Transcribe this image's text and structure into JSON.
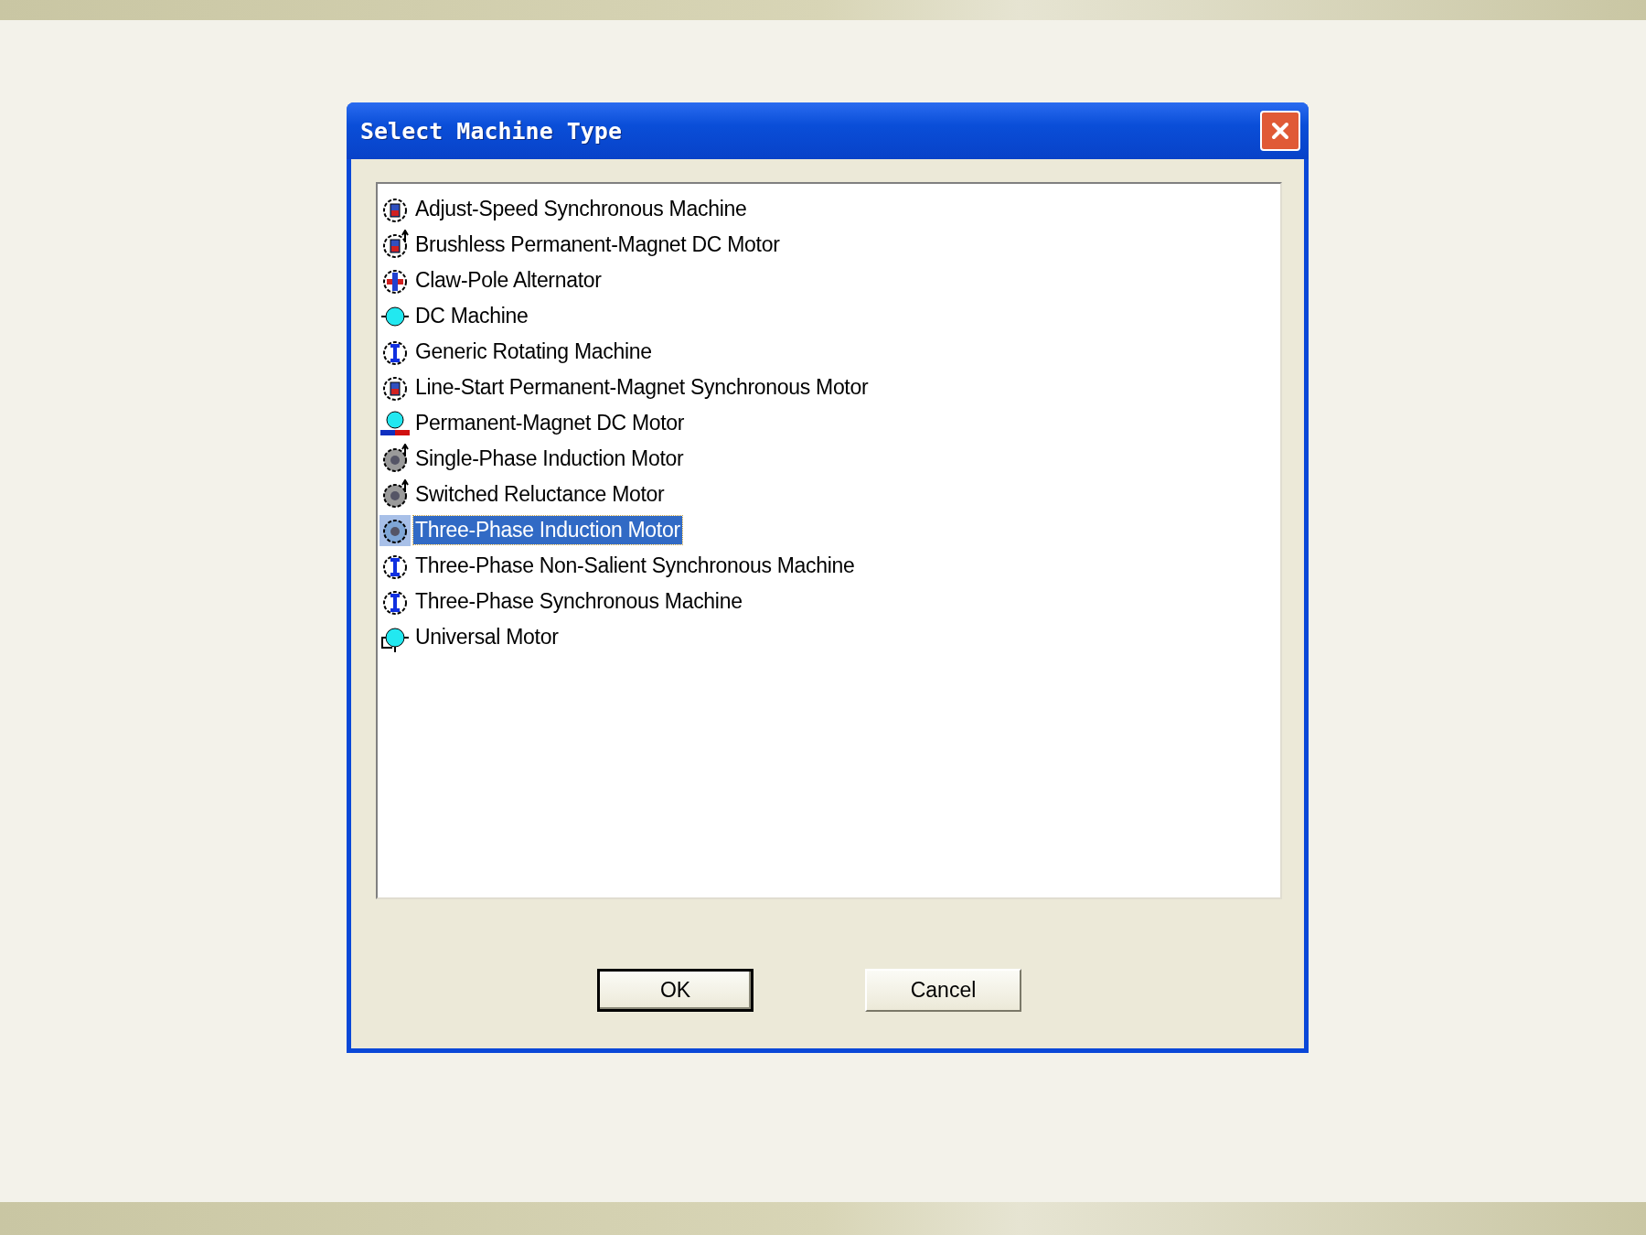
{
  "window": {
    "title": "Select Machine Type"
  },
  "machine_types": [
    {
      "label": "Adjust-Speed  Synchronous Machine",
      "selected": false
    },
    {
      "label": "Brushless Permanent-Magnet DC Motor",
      "selected": false
    },
    {
      "label": "Claw-Pole Alternator",
      "selected": false
    },
    {
      "label": "DC Machine",
      "selected": false
    },
    {
      "label": "Generic Rotating Machine",
      "selected": false
    },
    {
      "label": "Line-Start Permanent-Magnet Synchronous Motor",
      "selected": false
    },
    {
      "label": "Permanent-Magnet DC Motor",
      "selected": false
    },
    {
      "label": "Single-Phase Induction Motor",
      "selected": false
    },
    {
      "label": "Switched Reluctance Motor",
      "selected": false
    },
    {
      "label": "Three-Phase Induction Motor",
      "selected": true
    },
    {
      "label": "Three-Phase Non-Salient Synchronous Machine",
      "selected": false
    },
    {
      "label": "Three-Phase Synchronous Machine",
      "selected": false
    },
    {
      "label": "Universal Motor",
      "selected": false
    }
  ],
  "buttons": [
    {
      "label": "OK",
      "kind": "default"
    },
    {
      "label": "Cancel",
      "kind": "normal"
    }
  ]
}
